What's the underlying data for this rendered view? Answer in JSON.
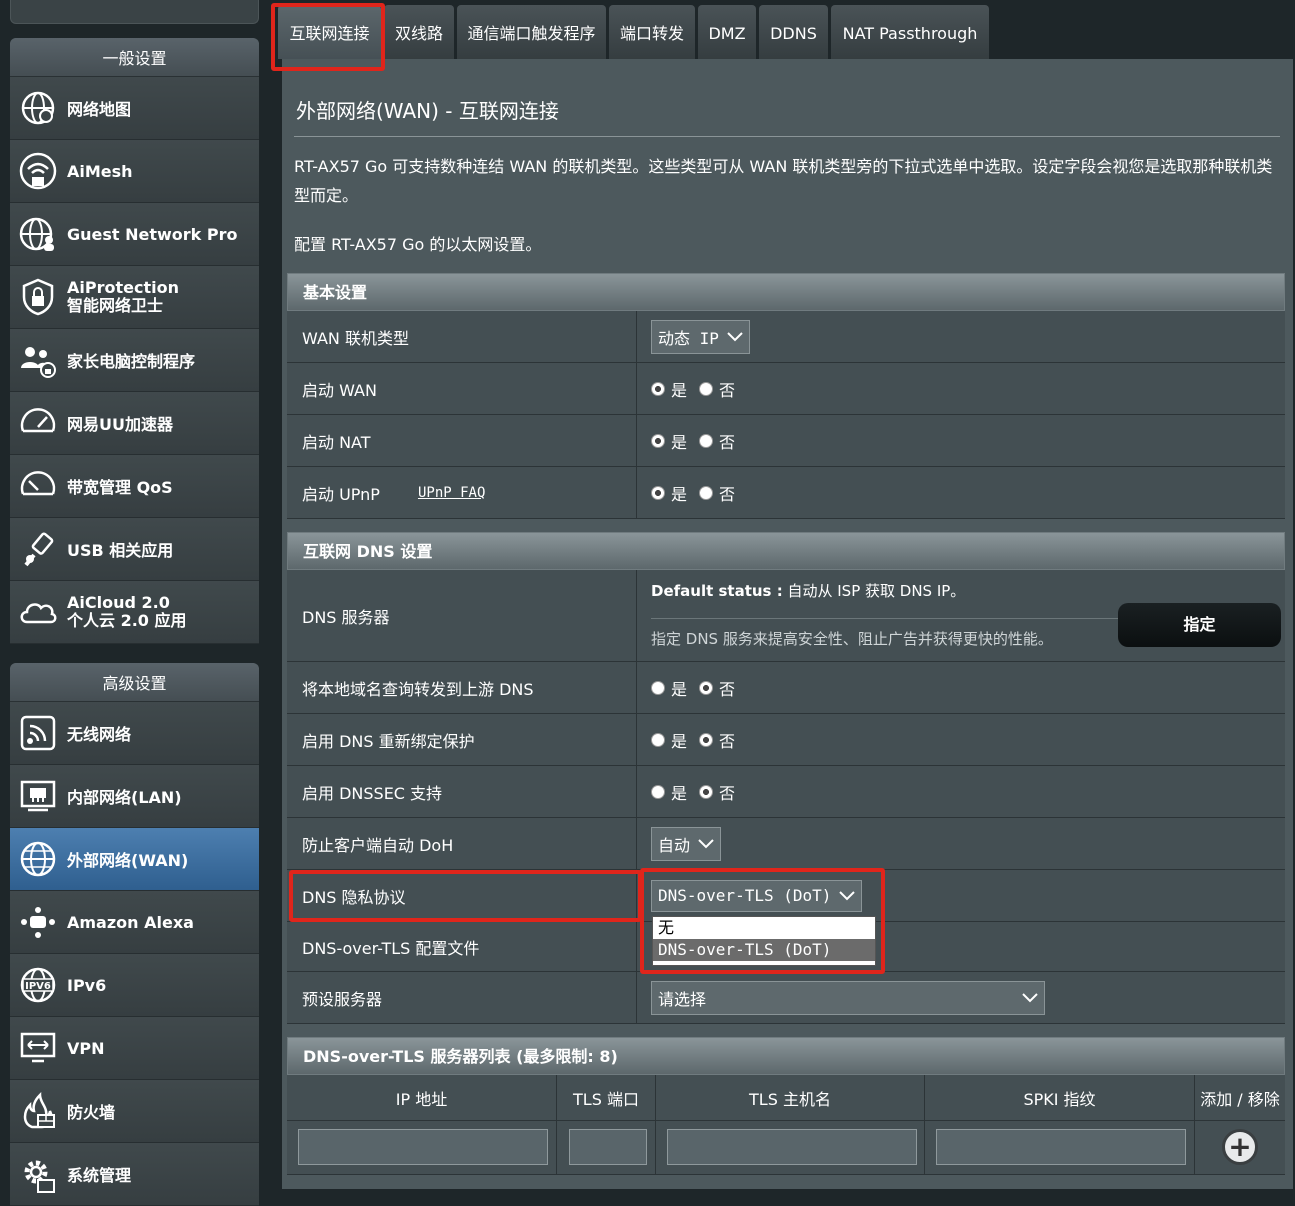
{
  "sidebar": {
    "general_header": "一般设置",
    "general_items": [
      {
        "label": "网络地图",
        "icon": "globe-map-icon"
      },
      {
        "label": "AiMesh",
        "icon": "aimesh-icon"
      },
      {
        "label": "Guest Network Pro",
        "icon": "guest-network-icon"
      },
      {
        "label": "AiProtection",
        "label2": "智能网络卫士",
        "icon": "shield-lock-icon"
      },
      {
        "label": "家长电脑控制程序",
        "icon": "parental-control-icon"
      },
      {
        "label": "网易UU加速器",
        "icon": "speedometer-icon"
      },
      {
        "label": "带宽管理 QoS",
        "icon": "qos-gauge-icon"
      },
      {
        "label": "USB 相关应用",
        "icon": "usb-icon"
      },
      {
        "label": "AiCloud 2.0",
        "label2": "个人云 2.0 应用",
        "icon": "cloud-icon"
      }
    ],
    "advanced_header": "高级设置",
    "advanced_items": [
      {
        "label": "无线网络",
        "icon": "wireless-icon"
      },
      {
        "label": "内部网络(LAN)",
        "icon": "lan-icon"
      },
      {
        "label": "外部网络(WAN)",
        "icon": "wan-globe-icon",
        "active": true
      },
      {
        "label": "Amazon Alexa",
        "icon": "alexa-icon"
      },
      {
        "label": "IPv6",
        "icon": "ipv6-icon"
      },
      {
        "label": "VPN",
        "icon": "vpn-icon"
      },
      {
        "label": "防火墙",
        "icon": "firewall-icon"
      },
      {
        "label": "系统管理",
        "icon": "gear-icon"
      }
    ]
  },
  "tabs": [
    "互联网连接",
    "双线路",
    "通信端口触发程序",
    "端口转发",
    "DMZ",
    "DDNS",
    "NAT Passthrough"
  ],
  "page": {
    "title": "外部网络(WAN) - 互联网连接",
    "desc1": "RT-AX57 Go 可支持数种连结 WAN 的联机类型。这些类型可从 WAN 联机类型旁的下拉式选单中选取。设定字段会视您是选取那种联机类型而定。",
    "desc2": "配置 RT-AX57 Go 的以太网设置。"
  },
  "basic": {
    "header": "基本设置",
    "wan_type_label": "WAN 联机类型",
    "wan_type_value": "动态 IP",
    "enable_wan_label": "启动 WAN",
    "enable_nat_label": "启动 NAT",
    "enable_upnp_label": "启动 UPnP",
    "upnp_faq": "UPnP  FAQ",
    "yes": "是",
    "no": "否"
  },
  "dns": {
    "header": "互联网 DNS 设置",
    "server_label": "DNS 服务器",
    "default_status_label": "Default status :",
    "default_status_value": " 自动从 ISP 获取 DNS IP。",
    "hint": "指定 DNS 服务来提高安全性、阻止广告并获得更快的性能。",
    "assign_button": "指定",
    "forward_label": "将本地域名查询转发到上游 DNS",
    "rebind_label": "启用 DNS 重新绑定保护",
    "dnssec_label": "启用 DNSSEC 支持",
    "doh_label": "防止客户端自动 DoH",
    "doh_value": "自动",
    "privacy_label": "DNS 隐私协议",
    "privacy_value": "DNS-over-TLS (DoT)",
    "privacy_options": [
      "无",
      "DNS-over-TLS (DoT)"
    ],
    "profile_label": "DNS-over-TLS 配置文件",
    "preset_label": "预设服务器",
    "preset_value": "请选择"
  },
  "dot_list": {
    "header": "DNS-over-TLS 服务器列表 (最多限制: 8)",
    "columns": [
      "IP 地址",
      "TLS 端口",
      "TLS 主机名",
      "SPKI 指纹",
      "添加 / 移除"
    ]
  },
  "colors": {
    "highlight": "#e0251b",
    "active_item": "#3b6c9c"
  }
}
